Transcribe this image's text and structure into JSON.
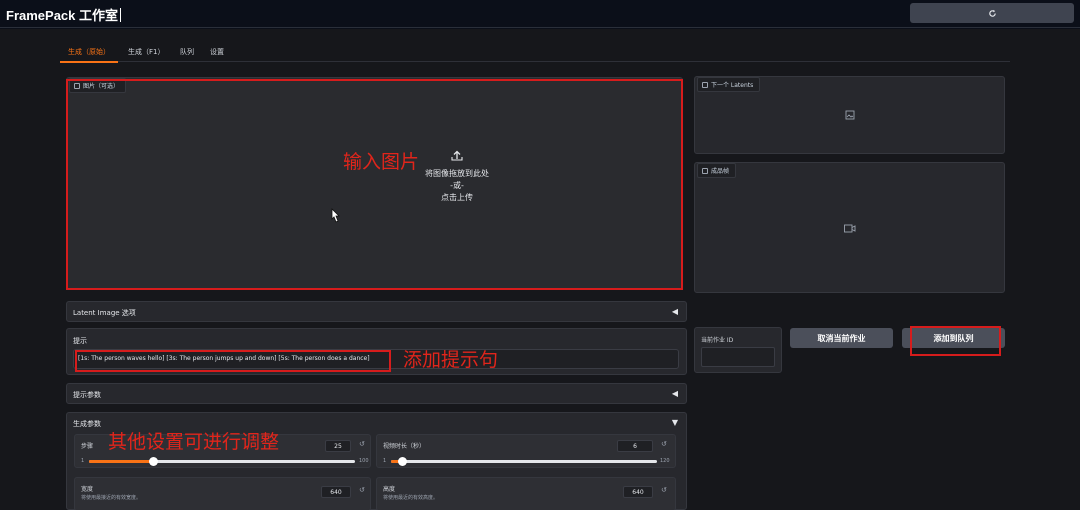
{
  "header": {
    "title": "FramePack 工作室",
    "refresh_icon": "refresh-icon"
  },
  "tabs": [
    "生成（原始）",
    "生成（F1）",
    "队列",
    "设置"
  ],
  "image_panel": {
    "label": "图片（可选）",
    "drop_text": "将图像拖放到此处",
    "or_text": "-或-",
    "upload_text": "点击上传"
  },
  "latents_panel": {
    "label": "下一个 Latents"
  },
  "video_panel": {
    "label": "成品帧"
  },
  "latent_options": {
    "title": "Latent Image 选项"
  },
  "prompt": {
    "label": "提示",
    "value": "[1s: The person waves hello] [3s: The person jumps up and down] [5s: The person does a dance]"
  },
  "prompt_params": {
    "title": "提示参数"
  },
  "gen_params": {
    "title": "生成参数",
    "steps": {
      "label": "步骤",
      "value": "25",
      "min": "1",
      "max": "100",
      "fraction": 0.24
    },
    "duration": {
      "label": "视频时长（秒）",
      "value": "6",
      "min": "1",
      "max": "120",
      "fraction": 0.042
    },
    "width": {
      "label": "宽度",
      "hint": "将使用最接近的有效宽度。",
      "value": "640"
    },
    "height": {
      "label": "高度",
      "hint": "将使用最近的有效高度。",
      "value": "640"
    }
  },
  "job": {
    "current_id_label": "当前作业 ID",
    "cancel_label": "取消当前作业",
    "add_queue_label": "添加到队列"
  },
  "annotations": {
    "input_image": "输入图片",
    "add_prompt": "添加提示句",
    "other_settings": "其他设置可进行调整"
  },
  "colors": {
    "accent": "#f97316",
    "annotation": "#e1251b",
    "background": "#16171b"
  }
}
